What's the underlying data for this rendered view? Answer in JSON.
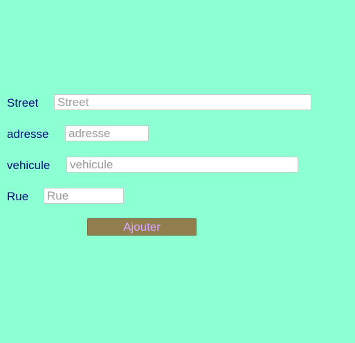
{
  "form": {
    "fields": [
      {
        "label": "Street",
        "placeholder": "Street",
        "value": ""
      },
      {
        "label": "adresse",
        "placeholder": "adresse",
        "value": ""
      },
      {
        "label": "vehicule",
        "placeholder": "vehicule",
        "value": ""
      },
      {
        "label": "Rue",
        "placeholder": "Rue",
        "value": ""
      }
    ],
    "submit_label": "Ajouter"
  },
  "colors": {
    "background": "#8cffd3",
    "label_text": "#0a0a7a",
    "button_background": "#917e4e",
    "button_text": "#d9a6ff",
    "placeholder_text": "#9a9a9a"
  }
}
